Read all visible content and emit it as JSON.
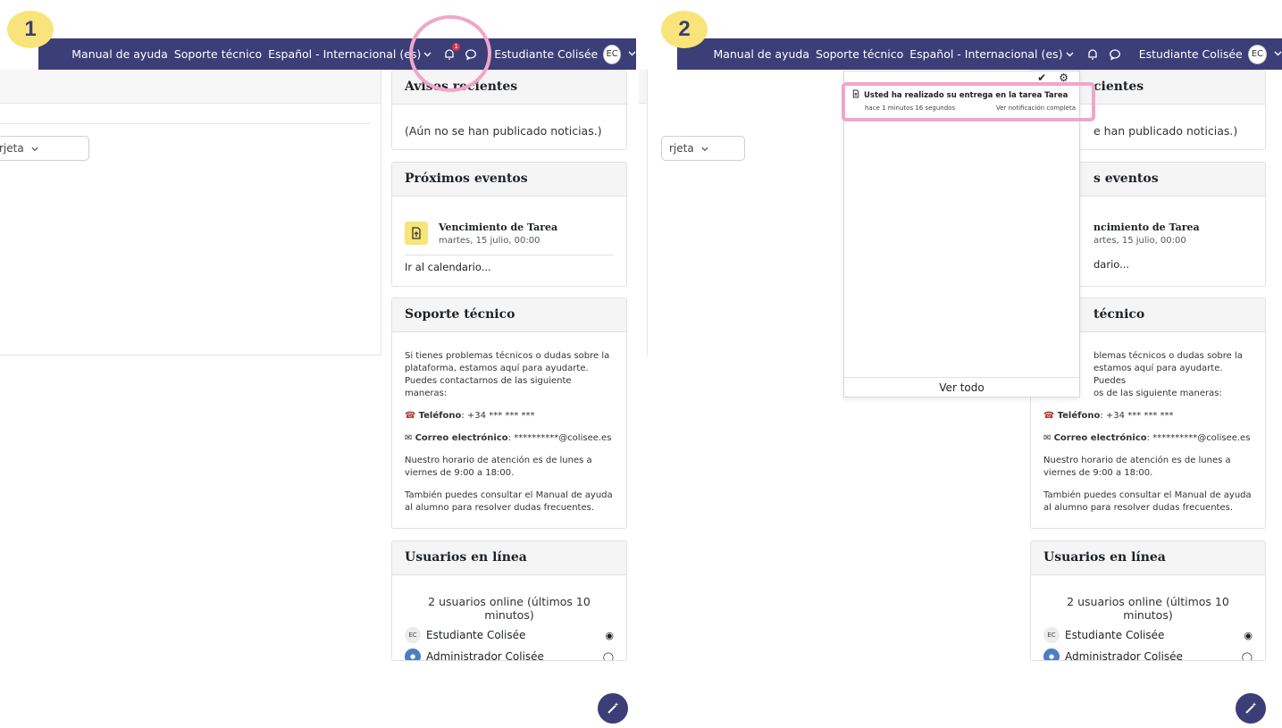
{
  "colors": {
    "navbar": "#3b3e77",
    "badge_yellow": "#f8e47a",
    "highlight_pink": "#f0a6c8",
    "alert_red": "#d9344f"
  },
  "icons": [
    "bell-icon",
    "chat-icon",
    "chevron-down-icon",
    "file-upload-icon",
    "phone-icon",
    "mail-icon",
    "eye-icon",
    "magic-wand-icon",
    "check-icon",
    "gear-icon"
  ],
  "navbar": {
    "help": "Manual de ayuda",
    "support": "Soporte técnico",
    "language": "Español - Internacional (es)",
    "user": "Estudiante Colisée",
    "avatar": "EC",
    "bell_count": "1"
  },
  "steps": {
    "one": "1",
    "two": "2"
  },
  "left": {
    "view_select_label": "rjeta"
  },
  "panel1": {
    "news": {
      "title": "Avisos recientes",
      "text": "(Aún no se han publicado noticias.)"
    },
    "events": {
      "title": "Próximos eventos",
      "item_title": "Vencimiento de Tarea",
      "item_date": "martes, 15 julio, 00:00",
      "calendar_link": "Ir al calendario..."
    },
    "support": {
      "title": "Soporte técnico"
    }
  },
  "support_body": {
    "intro": "Si tienes problemas técnicos o dudas sobre la plataforma, estamos aquí para ayudarte. Puedes contactarnos de las siguiente maneras:",
    "phone_label": "Teléfono",
    "phone_value": ": +34 *** *** ***",
    "email_label": "Correo electrónico",
    "email_value": ": **********@colisee.es",
    "hours": "Nuestro horario de atención es de lunes a viernes de 9:00 a 18:00.",
    "manual": "También puedes consultar el Manual de ayuda al alumno para resolver dudas frecuentes."
  },
  "online": {
    "title": "Usuarios en línea",
    "summary": "2 usuarios online (últimos 10 minutos)",
    "users": [
      {
        "avatar": "EC",
        "name": "Estudiante Colisée"
      },
      {
        "avatar": "",
        "name": "Administrador Colisée"
      }
    ]
  },
  "panel2": {
    "news_title": "cientes",
    "news_text": "e han publicado noticias.)",
    "events_title": "s eventos",
    "event_item_title": "ncimiento de Tarea",
    "event_item_date": "artes, 15 julio, 00:00",
    "calendar_link": "dario...",
    "support_title": "técnico",
    "support_line1": "blemas técnicos o dudas sobre la",
    "support_line2": "estamos aquí para ayudarte. Puedes",
    "support_line3": "os de las siguiente maneras:"
  },
  "notifications": {
    "item_text": "Usted ha realizado su entrega en la tarea Tarea",
    "item_time": "hace 1 minutos 16 segundos",
    "item_link": "Ver notificación completa",
    "footer": "Ver todo"
  }
}
